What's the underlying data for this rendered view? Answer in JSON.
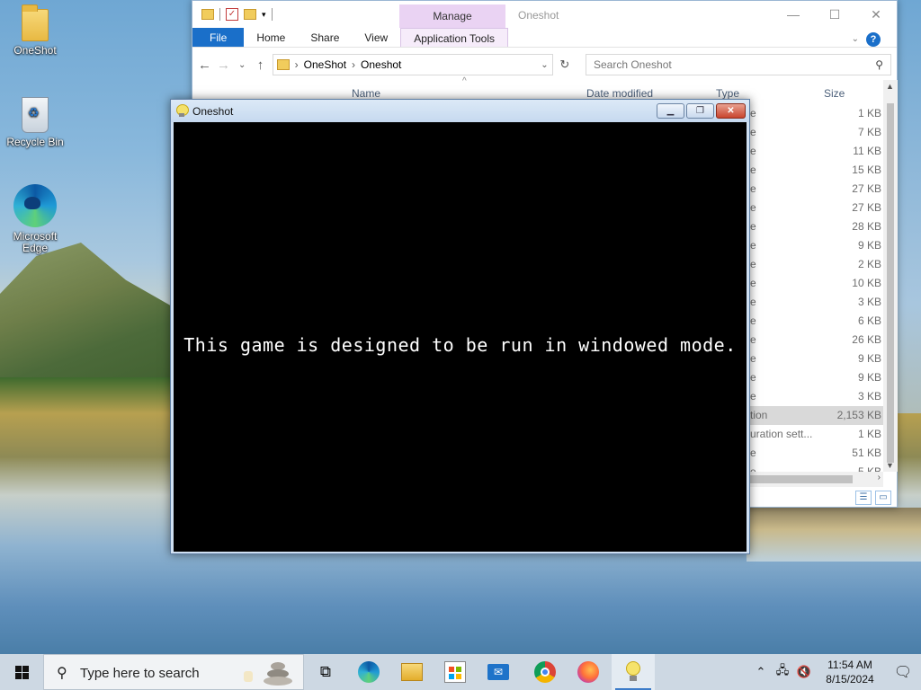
{
  "desktop": {
    "icons": [
      {
        "label": "OneShot"
      },
      {
        "label": "Recycle Bin"
      },
      {
        "label": "Microsoft Edge"
      }
    ]
  },
  "explorer": {
    "title": "Oneshot",
    "manage_tab": "Manage",
    "ribbon_tabs": [
      "File",
      "Home",
      "Share",
      "View",
      "Application Tools"
    ],
    "breadcrumb": [
      "OneShot",
      "Oneshot"
    ],
    "search_placeholder": "Search Oneshot",
    "columns": {
      "name": "Name",
      "date": "Date modified",
      "type": "Type",
      "size": "Size"
    },
    "rows": [
      {
        "type": "e",
        "size": "1 KB"
      },
      {
        "type": "e",
        "size": "7 KB"
      },
      {
        "type": "e",
        "size": "11 KB"
      },
      {
        "type": "e",
        "size": "15 KB"
      },
      {
        "type": "e",
        "size": "27 KB"
      },
      {
        "type": "e",
        "size": "27 KB"
      },
      {
        "type": "e",
        "size": "28 KB"
      },
      {
        "type": "e",
        "size": "9 KB"
      },
      {
        "type": "e",
        "size": "2 KB"
      },
      {
        "type": "e",
        "size": "10 KB"
      },
      {
        "type": "e",
        "size": "3 KB"
      },
      {
        "type": "e",
        "size": "6 KB"
      },
      {
        "type": "e",
        "size": "26 KB"
      },
      {
        "type": "e",
        "size": "9 KB"
      },
      {
        "type": "e",
        "size": "9 KB"
      },
      {
        "type": "e",
        "size": "3 KB"
      },
      {
        "type": "tion",
        "size": "2,153 KB",
        "selected": true
      },
      {
        "type": "uration sett...",
        "size": "1 KB"
      },
      {
        "type": "e",
        "size": "51 KB"
      },
      {
        "type": "e",
        "size": "5 KB"
      }
    ]
  },
  "game_window": {
    "title": "Oneshot",
    "message": "This game is designed to be run in windowed mode."
  },
  "taskbar": {
    "search_placeholder": "Type here to search",
    "time": "11:54 AM",
    "date": "8/15/2024"
  }
}
